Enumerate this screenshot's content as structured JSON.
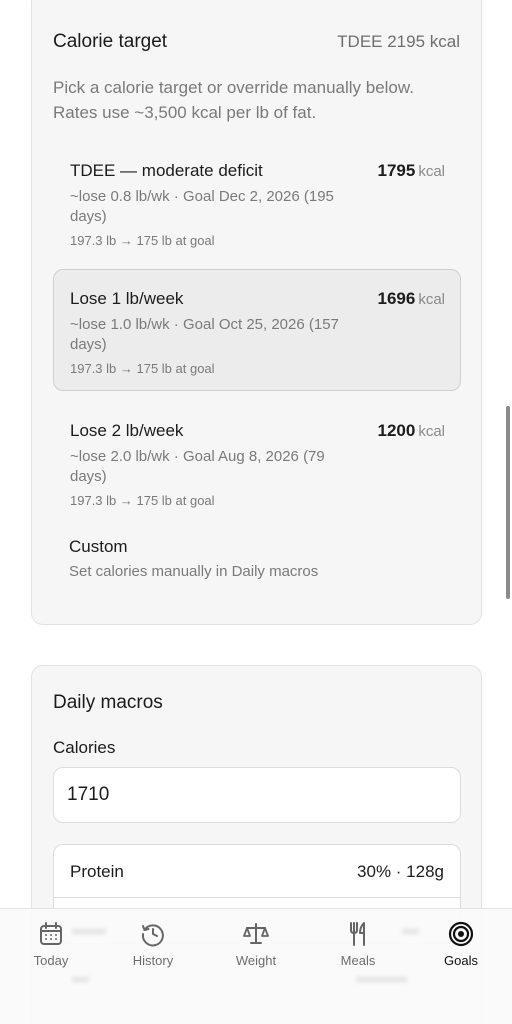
{
  "calorie_target": {
    "title": "Calorie target",
    "tdee_label": "TDEE 2195 kcal",
    "description": "Pick a calorie target or override manually below. Rates use ~3,500 kcal per lb of fat.",
    "options": [
      {
        "name": "TDEE — moderate deficit",
        "kcal": "1795",
        "unit": "kcal",
        "sub": "~lose 0.8 lb/wk · Goal Dec 2, 2026 (195 days)",
        "meta": "197.3 lb → 175 lb at goal",
        "selected": false
      },
      {
        "name": "Lose 1 lb/week",
        "kcal": "1696",
        "unit": "kcal",
        "sub": "~lose 1.0 lb/wk · Goal Oct 25, 2026 (157 days)",
        "meta": "197.3 lb → 175 lb at goal",
        "selected": true
      },
      {
        "name": "Lose 2 lb/week",
        "kcal": "1200",
        "unit": "kcal",
        "sub": "~lose 2.0 lb/wk · Goal Aug 8, 2026 (79 days)",
        "meta": "197.3 lb → 175 lb at goal",
        "selected": false
      }
    ],
    "custom": {
      "name": "Custom",
      "sub": "Set calories manually in Daily macros"
    }
  },
  "daily_macros": {
    "title": "Daily macros",
    "calories_label": "Calories",
    "calories_value": "1710",
    "protein": {
      "name": "Protein",
      "value": "30% · 128g"
    }
  },
  "nav": {
    "items": [
      {
        "label": "Today",
        "icon": "calendar-icon",
        "active": false
      },
      {
        "label": "History",
        "icon": "history-icon",
        "active": false
      },
      {
        "label": "Weight",
        "icon": "scale-icon",
        "active": false
      },
      {
        "label": "Meals",
        "icon": "utensils-icon",
        "active": false
      },
      {
        "label": "Goals",
        "icon": "target-icon",
        "active": true
      }
    ]
  }
}
